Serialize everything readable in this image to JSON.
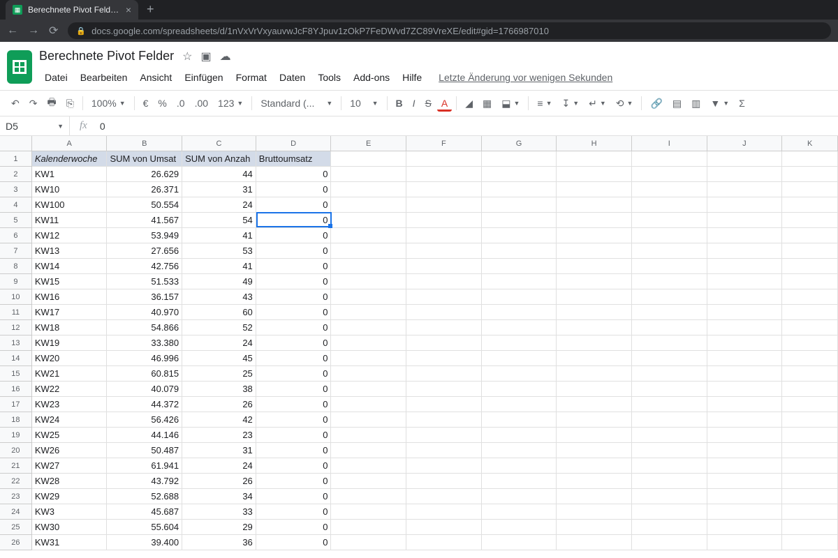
{
  "browser": {
    "tab_title": "Berechnete Pivot Felder - Googl",
    "url": "docs.google.com/spreadsheets/d/1nVxVrVxyauvwJcF8YJpuv1zOkP7FeDWvd7ZC89VreXE/edit#gid=1766987010"
  },
  "doc": {
    "title": "Berechnete Pivot Felder",
    "last_edit": "Letzte Änderung vor wenigen Sekunden"
  },
  "menu": [
    "Datei",
    "Bearbeiten",
    "Ansicht",
    "Einfügen",
    "Format",
    "Daten",
    "Tools",
    "Add-ons",
    "Hilfe"
  ],
  "toolbar": {
    "zoom": "100%",
    "font": "Standard (...",
    "size": "10"
  },
  "formula": {
    "cell_ref": "D5",
    "value": "0"
  },
  "columns": [
    "A",
    "B",
    "C",
    "D",
    "E",
    "F",
    "G",
    "H",
    "I",
    "J",
    "K"
  ],
  "col_classes": [
    "cA",
    "cB",
    "cC",
    "cD",
    "cE",
    "cF",
    "cG",
    "cH",
    "cI",
    "cJ",
    "cK"
  ],
  "headers": [
    "Kalenderwoche",
    "SUM von Umsat",
    "SUM von Anzah",
    "Bruttoumsatz"
  ],
  "rows": [
    {
      "a": "KW1",
      "b": "26.629",
      "c": "44",
      "d": "0"
    },
    {
      "a": "KW10",
      "b": "26.371",
      "c": "31",
      "d": "0"
    },
    {
      "a": "KW100",
      "b": "50.554",
      "c": "24",
      "d": "0"
    },
    {
      "a": "KW11",
      "b": "41.567",
      "c": "54",
      "d": "0"
    },
    {
      "a": "KW12",
      "b": "53.949",
      "c": "41",
      "d": "0"
    },
    {
      "a": "KW13",
      "b": "27.656",
      "c": "53",
      "d": "0"
    },
    {
      "a": "KW14",
      "b": "42.756",
      "c": "41",
      "d": "0"
    },
    {
      "a": "KW15",
      "b": "51.533",
      "c": "49",
      "d": "0"
    },
    {
      "a": "KW16",
      "b": "36.157",
      "c": "43",
      "d": "0"
    },
    {
      "a": "KW17",
      "b": "40.970",
      "c": "60",
      "d": "0"
    },
    {
      "a": "KW18",
      "b": "54.866",
      "c": "52",
      "d": "0"
    },
    {
      "a": "KW19",
      "b": "33.380",
      "c": "24",
      "d": "0"
    },
    {
      "a": "KW20",
      "b": "46.996",
      "c": "45",
      "d": "0"
    },
    {
      "a": "KW21",
      "b": "60.815",
      "c": "25",
      "d": "0"
    },
    {
      "a": "KW22",
      "b": "40.079",
      "c": "38",
      "d": "0"
    },
    {
      "a": "KW23",
      "b": "44.372",
      "c": "26",
      "d": "0"
    },
    {
      "a": "KW24",
      "b": "56.426",
      "c": "42",
      "d": "0"
    },
    {
      "a": "KW25",
      "b": "44.146",
      "c": "23",
      "d": "0"
    },
    {
      "a": "KW26",
      "b": "50.487",
      "c": "31",
      "d": "0"
    },
    {
      "a": "KW27",
      "b": "61.941",
      "c": "24",
      "d": "0"
    },
    {
      "a": "KW28",
      "b": "43.792",
      "c": "26",
      "d": "0"
    },
    {
      "a": "KW29",
      "b": "52.688",
      "c": "34",
      "d": "0"
    },
    {
      "a": "KW3",
      "b": "45.687",
      "c": "33",
      "d": "0"
    },
    {
      "a": "KW30",
      "b": "55.604",
      "c": "29",
      "d": "0"
    },
    {
      "a": "KW31",
      "b": "39.400",
      "c": "36",
      "d": "0"
    }
  ],
  "selected": {
    "row_index": 3,
    "col_class": "cD"
  }
}
